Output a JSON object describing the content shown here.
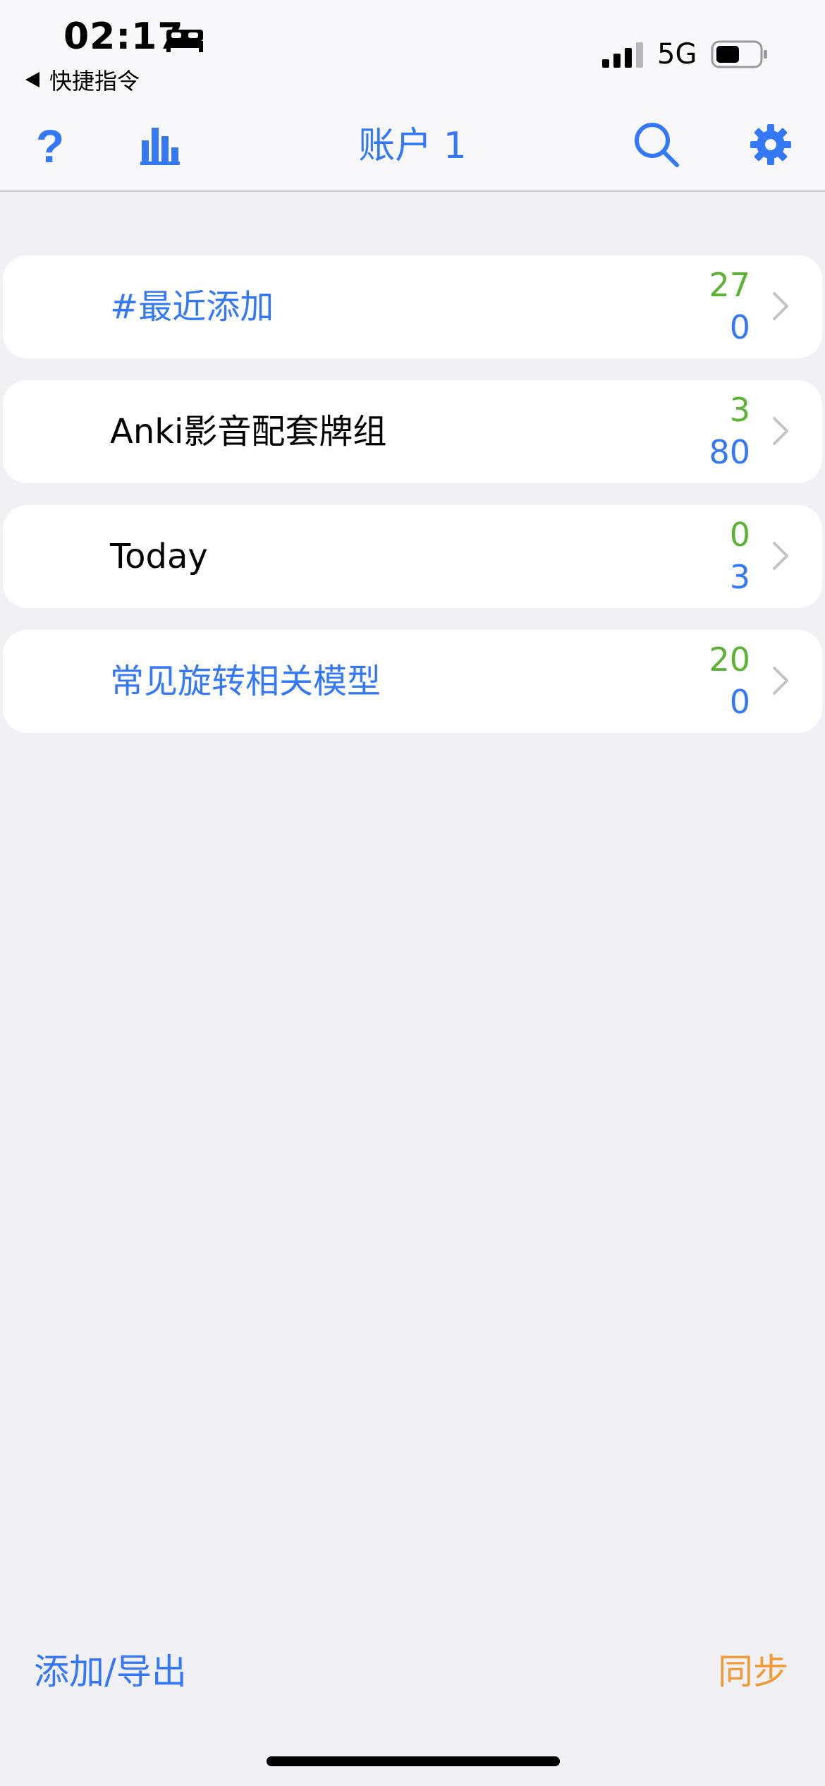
{
  "status_bar": {
    "time": "02:17",
    "back_label": "快捷指令",
    "network": "5G"
  },
  "nav": {
    "title": "账户 1",
    "help_label": "?"
  },
  "decks": [
    {
      "name": "#最近添加",
      "new_count": "27",
      "due_count": "0",
      "name_color": "blue"
    },
    {
      "name": "Anki影音配套牌组",
      "new_count": "3",
      "due_count": "80",
      "name_color": "black"
    },
    {
      "name": "Today",
      "new_count": "0",
      "due_count": "3",
      "name_color": "black"
    },
    {
      "name": "常见旋转相关模型",
      "new_count": "20",
      "due_count": "0",
      "name_color": "blue"
    }
  ],
  "toolbar": {
    "add_export_label": "添加/导出",
    "sync_label": "同步"
  },
  "colors": {
    "accent_blue": "#3478f6",
    "new_green": "#5cb235",
    "sync_orange": "#f29b35",
    "background": "#f0f0f5"
  }
}
